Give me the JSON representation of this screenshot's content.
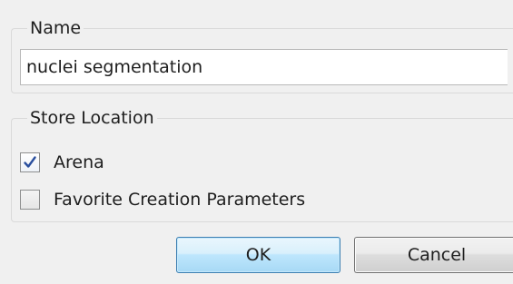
{
  "name_group": {
    "legend": "Name",
    "input_value": "nuclei segmentation"
  },
  "store_location": {
    "legend": "Store Location",
    "options": [
      {
        "label": "Arena",
        "checked": true
      },
      {
        "label": "Favorite Creation Parameters",
        "checked": false
      }
    ]
  },
  "buttons": {
    "ok_label": "OK",
    "cancel_label": "Cancel"
  },
  "colors": {
    "check_mark": "#2a4f9e",
    "ok_border": "#3c7fb1"
  },
  "icons": {
    "checkbox_checked": "checkmark-icon"
  }
}
